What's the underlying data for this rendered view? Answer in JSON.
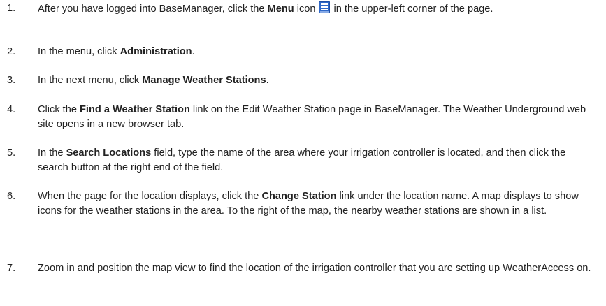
{
  "steps": [
    {
      "num": "1.",
      "t1": "After you have logged into BaseManager, click the ",
      "b1": "Menu",
      "t2": " icon",
      "t3": "in the upper-left corner of the page."
    },
    {
      "num": "2.",
      "t1": "In the menu, click ",
      "b1": "Administration",
      "t2": "."
    },
    {
      "num": "3.",
      "t1": "In the next menu, click ",
      "b1": "Manage Weather Stations",
      "t2": "."
    },
    {
      "num": "4.",
      "t1": "Click the ",
      "b1": "Find a Weather Station",
      "t2": " link on the Edit Weather Station page in BaseManager. The Weather Underground web site opens in a new browser tab."
    },
    {
      "num": "5.",
      "t1": "In the ",
      "b1": "Search Locations",
      "t2": " field, type the name of the area where your irrigation controller is located, and then click the search button at the right end of the field."
    },
    {
      "num": "6.",
      "t1": "When the page for the location displays, click the ",
      "b1": "Change Station",
      "t2": " link under the location name. A map displays to show icons for the weather stations in the area. To the right of the map, the nearby weather stations are shown in a list."
    },
    {
      "num": "7.",
      "t1": "Zoom in and position the map view to find the location of the irrigation controller that you are setting up WeatherAccess on."
    }
  ],
  "icons": {
    "menu": "menu-icon",
    "menu_color": "#2f68c8"
  }
}
